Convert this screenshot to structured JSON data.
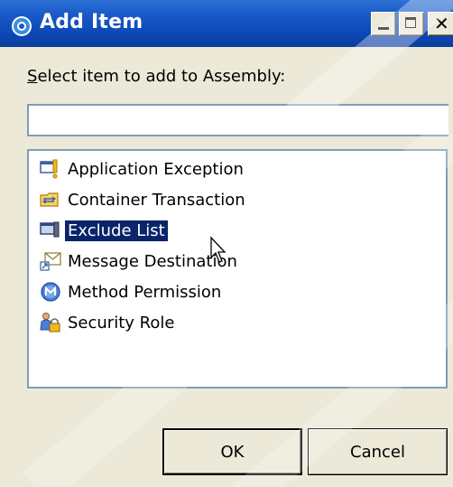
{
  "window": {
    "title": "Add Item",
    "title_icon": "eclipse-dialog-icon",
    "controls": {
      "minimize_icon": "minimize-icon",
      "maximize_icon": "maximize-icon",
      "close_glyph": "✕"
    }
  },
  "prompt": {
    "mnemonic": "S",
    "rest": "elect item to add to Assembly:"
  },
  "search": {
    "value": "",
    "placeholder": ""
  },
  "list": {
    "items": [
      {
        "label": "Application Exception",
        "icon": "application-exception-icon",
        "selected": false
      },
      {
        "label": "Container Transaction",
        "icon": "container-transaction-icon",
        "selected": false
      },
      {
        "label": "Exclude List",
        "icon": "exclude-list-icon",
        "selected": true
      },
      {
        "label": "Message Destination",
        "icon": "message-destination-icon",
        "selected": false
      },
      {
        "label": "Method Permission",
        "icon": "method-permission-icon",
        "selected": false
      },
      {
        "label": "Security Role",
        "icon": "security-role-icon",
        "selected": false
      }
    ]
  },
  "buttons": {
    "ok_label": "OK",
    "cancel_label": "Cancel"
  },
  "colors": {
    "titlebar": "#0d48b8",
    "dialog_bg": "#ece9d8",
    "selection_bg": "#0a246a",
    "field_border": "#7f9db9"
  }
}
